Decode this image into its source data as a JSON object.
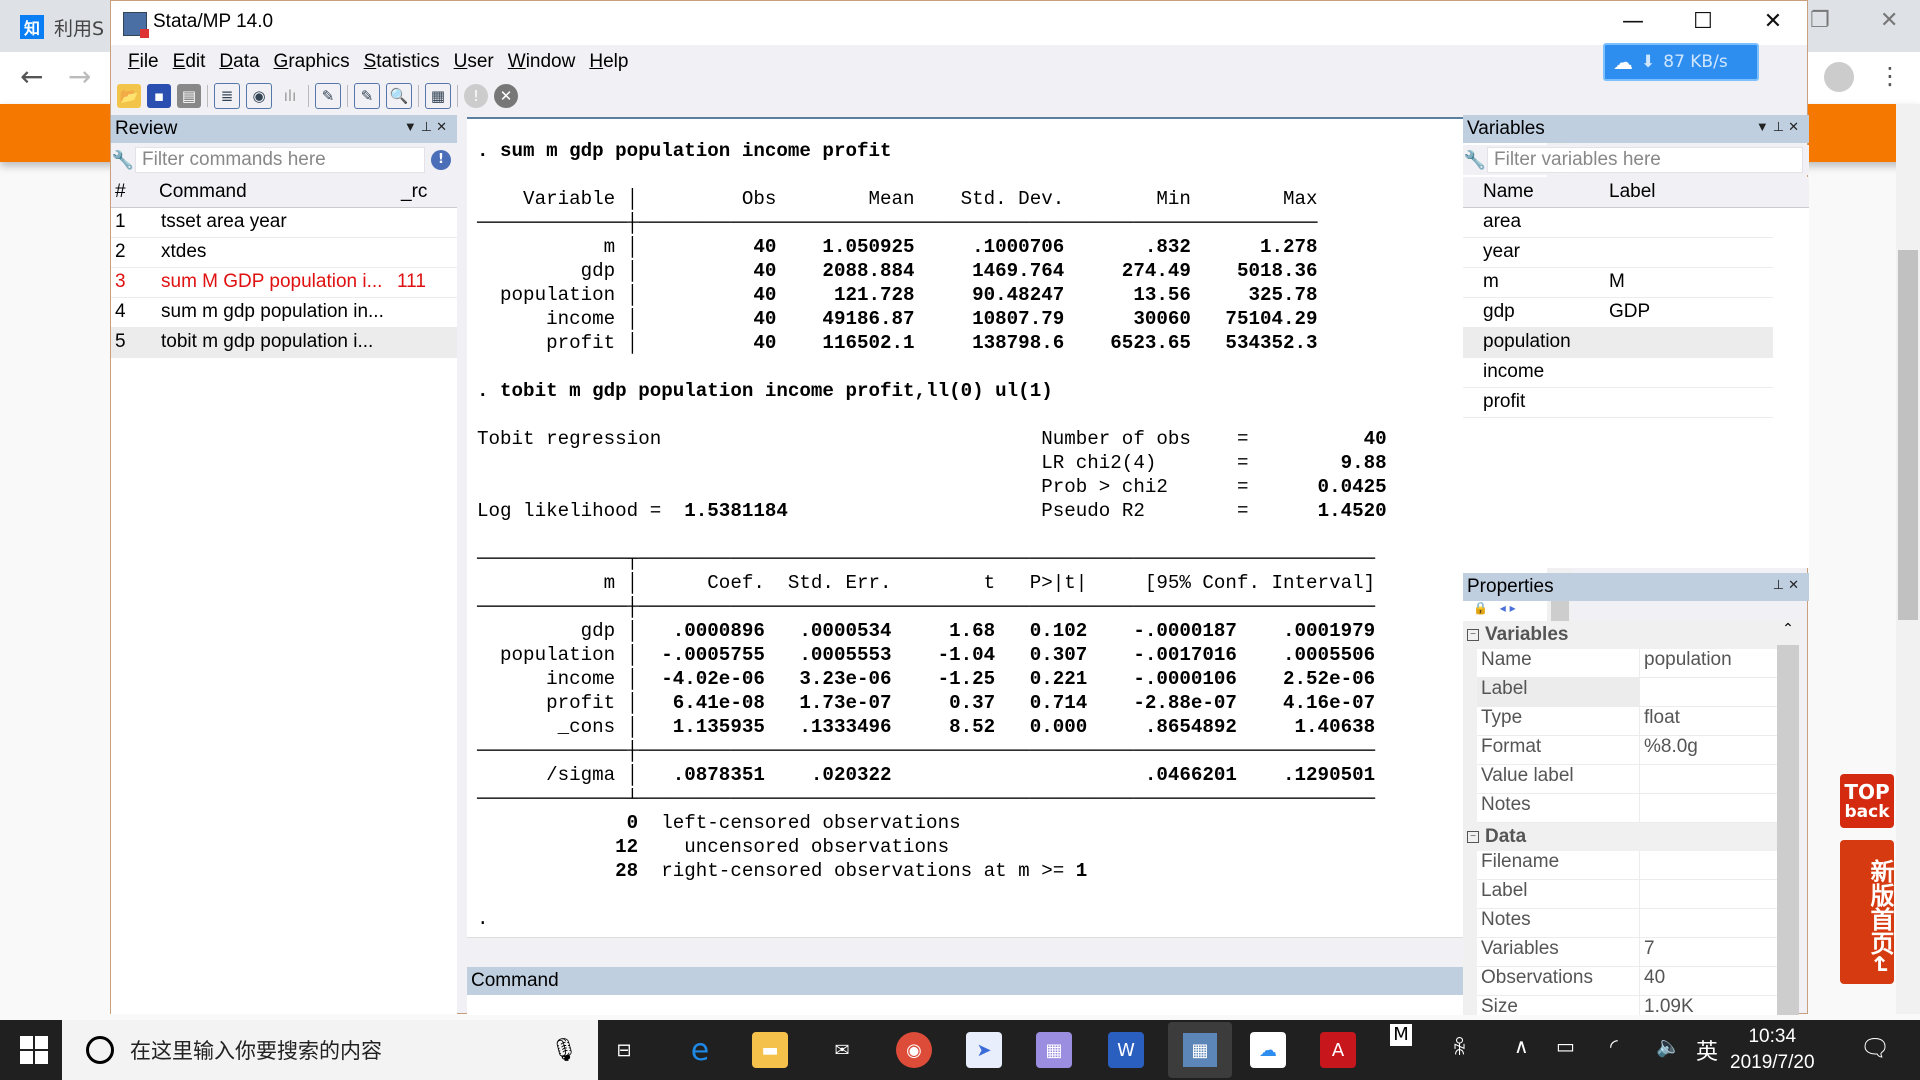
{
  "browser": {
    "tab_title": "利用S",
    "tab_icon": "知",
    "back_icon": "←",
    "forward_icon": "→",
    "float_top": [
      "TOP",
      "back"
    ],
    "float_home": "新版首页"
  },
  "window": {
    "title": "Stata/MP 14.0",
    "minimize": "—",
    "maximize": "☐",
    "close": "✕"
  },
  "menu": [
    "File",
    "Edit",
    "Data",
    "Graphics",
    "Statistics",
    "User",
    "Window",
    "Help"
  ],
  "speed_badge": "87 KB/s",
  "review": {
    "title": "Review",
    "filter_placeholder": "Filter commands here",
    "col_num": "#",
    "col_command": "Command",
    "col_rc": "_rc",
    "items": [
      {
        "n": "1",
        "cmd": "tsset area year",
        "rc": "",
        "error": false
      },
      {
        "n": "2",
        "cmd": "xtdes",
        "rc": "",
        "error": false
      },
      {
        "n": "3",
        "cmd": "sum M GDP population i...",
        "rc": "111",
        "error": true
      },
      {
        "n": "4",
        "cmd": "sum m gdp population in...",
        "rc": "",
        "error": false
      },
      {
        "n": "5",
        "cmd": "tobit m gdp population i...",
        "rc": "",
        "error": false
      }
    ]
  },
  "results": {
    "cmd1": ". sum m gdp population income profit",
    "sum_header": "    Variable         Obs        Mean    Std. Dev.       Min        Max",
    "sum_rows": [
      {
        "var": "m",
        "obs": "40",
        "mean": "1.050925",
        "sd": ".1000706",
        "min": ".832",
        "max": "1.278"
      },
      {
        "var": "gdp",
        "obs": "40",
        "mean": "2088.884",
        "sd": "1469.764",
        "min": "274.49",
        "max": "5018.36"
      },
      {
        "var": "population",
        "obs": "40",
        "mean": "121.728",
        "sd": "90.48247",
        "min": "13.56",
        "max": "325.78"
      },
      {
        "var": "income",
        "obs": "40",
        "mean": "49186.87",
        "sd": "10807.79",
        "min": "30060",
        "max": "75104.29"
      },
      {
        "var": "profit",
        "obs": "40",
        "mean": "116502.1",
        "sd": "138798.6",
        "min": "6523.65",
        "max": "534352.3"
      }
    ],
    "cmd2": ". tobit m gdp population income profit,ll(0) ul(1)",
    "model_title": "Tobit regression",
    "loglik_label": "Log likelihood =",
    "loglik_value": "1.5381184",
    "stats": [
      {
        "label": "Number of obs",
        "value": "40"
      },
      {
        "label": "LR chi2(4)",
        "value": "9.88"
      },
      {
        "label": "Prob > chi2",
        "value": "0.0425"
      },
      {
        "label": "Pseudo R2",
        "value": "1.4520"
      }
    ],
    "coef_header": {
      "dep": "m",
      "coef": "Coef.",
      "se": "Std. Err.",
      "t": "t",
      "p": "P>|t|",
      "ci": "[95% Conf. Interval]"
    },
    "coef_rows": [
      {
        "var": "gdp",
        "coef": ".0000896",
        "se": ".0000534",
        "t": "1.68",
        "p": "0.102",
        "lo": "-.0000187",
        "hi": ".0001979"
      },
      {
        "var": "population",
        "coef": "-.0005755",
        "se": ".0005553",
        "t": "-1.04",
        "p": "0.307",
        "lo": "-.0017016",
        "hi": ".0005506"
      },
      {
        "var": "income",
        "coef": "-4.02e-06",
        "se": "3.23e-06",
        "t": "-1.25",
        "p": "0.221",
        "lo": "-.0000106",
        "hi": "2.52e-06"
      },
      {
        "var": "profit",
        "coef": "6.41e-08",
        "se": "1.73e-07",
        "t": "0.37",
        "p": "0.714",
        "lo": "-2.88e-07",
        "hi": "4.16e-07"
      },
      {
        "var": "_cons",
        "coef": "1.135935",
        "se": ".1333496",
        "t": "8.52",
        "p": "0.000",
        "lo": ".8654892",
        "hi": "1.40638"
      }
    ],
    "sigma_row": {
      "var": "/sigma",
      "coef": ".0878351",
      "se": ".020322",
      "lo": ".0466201",
      "hi": ".1290501"
    },
    "censor": [
      {
        "n": "0",
        "text": "left-censored observations"
      },
      {
        "n": "12",
        "text": "  uncensored observations"
      },
      {
        "n": "28",
        "text": "right-censored observations at m >= 1"
      }
    ],
    "prompt": "."
  },
  "command_panel": {
    "title": "Command"
  },
  "variables": {
    "title": "Variables",
    "filter_placeholder": "Filter variables here",
    "col_name": "Name",
    "col_label": "Label",
    "items": [
      {
        "name": "area",
        "label": ""
      },
      {
        "name": "year",
        "label": ""
      },
      {
        "name": "m",
        "label": "M"
      },
      {
        "name": "gdp",
        "label": "GDP"
      },
      {
        "name": "population",
        "label": ""
      },
      {
        "name": "income",
        "label": ""
      },
      {
        "name": "profit",
        "label": ""
      }
    ],
    "selected": "population"
  },
  "properties": {
    "title": "Properties",
    "sec_variables": "Variables",
    "var_rows": [
      {
        "k": "Name",
        "v": "population"
      },
      {
        "k": "Label",
        "v": ""
      },
      {
        "k": "Type",
        "v": "float"
      },
      {
        "k": "Format",
        "v": "%8.0g"
      },
      {
        "k": "Value label",
        "v": ""
      },
      {
        "k": "Notes",
        "v": ""
      }
    ],
    "sec_data": "Data",
    "data_rows": [
      {
        "k": "Filename",
        "v": ""
      },
      {
        "k": "Label",
        "v": ""
      },
      {
        "k": "Notes",
        "v": ""
      },
      {
        "k": "Variables",
        "v": "7"
      },
      {
        "k": "Observations",
        "v": "40"
      },
      {
        "k": "Size",
        "v": "1.09K"
      }
    ]
  },
  "taskbar": {
    "search_placeholder": "在这里输入你要搜索的内容",
    "ime": "英",
    "time": "10:34",
    "date": "2019/7/20"
  }
}
